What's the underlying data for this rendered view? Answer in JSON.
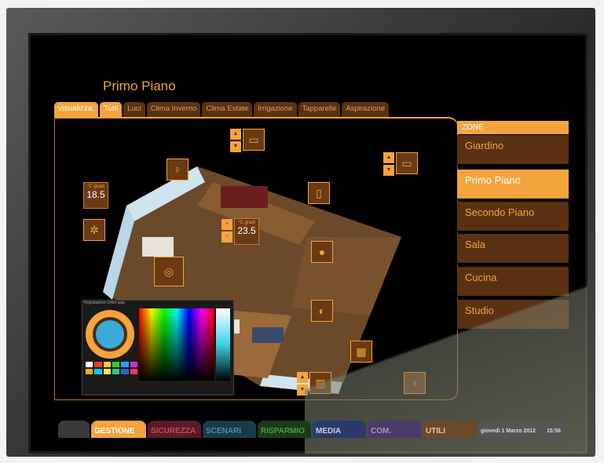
{
  "header": {
    "title": "Primo Piano"
  },
  "filter": {
    "label": "visualizza:",
    "tabs": [
      "Tutti",
      "Luci",
      "Clima Inverno",
      "Clima Estate",
      "Irrigazione",
      "Tapparelle",
      "Aspirazione"
    ]
  },
  "zones": {
    "header": "ZONE",
    "items": [
      "Giardino",
      "Primo Piano",
      "Secondo Piano",
      "Sala",
      "Cucina",
      "Studio"
    ]
  },
  "temps": {
    "left": {
      "unit": "°C gradi",
      "value": "18.5"
    },
    "center": {
      "unit": "°C gradi",
      "value": "23.5"
    }
  },
  "picker": {
    "title": "Regolazione colori sala"
  },
  "bottom_nav": {
    "items": [
      "GESTIONE",
      "SICUREZZA",
      "SCENARI",
      "RISPARMIO",
      "MEDIA",
      "COM.",
      "UTILI"
    ],
    "datetime": "giovedì 1 Marzo 2012",
    "time": "15:56"
  },
  "colors": {
    "accent": "#f3a43c",
    "panel": "#5a3112"
  }
}
